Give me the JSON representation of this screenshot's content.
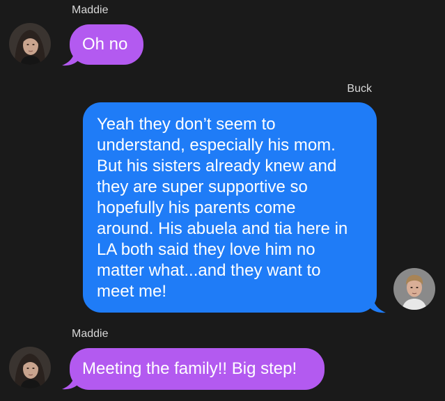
{
  "colors": {
    "background": "#1a1a1a",
    "incoming_bubble": "#b35af0",
    "outgoing_bubble": "#1f7cf7",
    "sender_name_text": "#d8d8d8"
  },
  "messages": [
    {
      "sender": "Maddie",
      "direction": "incoming",
      "avatar_icon": "maddie-avatar",
      "text": "Oh no"
    },
    {
      "sender": "Buck",
      "direction": "outgoing",
      "avatar_icon": "buck-avatar",
      "text": "Yeah they don’t seem to\nunderstand, especially his mom.\nBut his sisters already knew and\nthey are super supportive so\nhopefully his parents come\naround. His abuela and tia here in\nLA both said they love him no\nmatter what...and they want to\nmeet me!"
    },
    {
      "sender": "Maddie",
      "direction": "incoming",
      "avatar_icon": "maddie-avatar",
      "text": "Meeting the family!! Big step!"
    }
  ]
}
